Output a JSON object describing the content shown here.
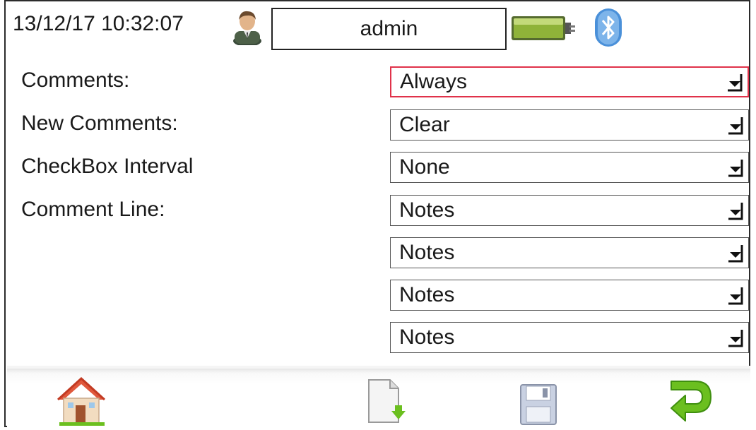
{
  "header": {
    "datetime": "13/12/17 10:32:07",
    "user_icon": "user-avatar-icon",
    "username": "admin",
    "battery_icon": "battery-charging-icon",
    "bluetooth_icon": "bluetooth-icon"
  },
  "form": {
    "rows": [
      {
        "label": "Comments:",
        "value": "Always"
      },
      {
        "label": "New Comments:",
        "value": "Clear"
      },
      {
        "label": "CheckBox Interval",
        "value": "None"
      },
      {
        "label": "Comment Line:",
        "value": "Notes"
      },
      {
        "label": "",
        "value": "Notes"
      },
      {
        "label": "",
        "value": "Notes"
      },
      {
        "label": "",
        "value": "Notes"
      }
    ]
  },
  "toolbar": {
    "home_icon": "home-icon",
    "export_icon": "export-file-icon",
    "save_icon": "save-disk-icon",
    "back_icon": "return-arrow-icon"
  },
  "colors": {
    "focus_border": "#e0324a",
    "battery": "#8fb339",
    "bluetooth": "#4a90d9",
    "return_arrow": "#6bbf1f"
  }
}
